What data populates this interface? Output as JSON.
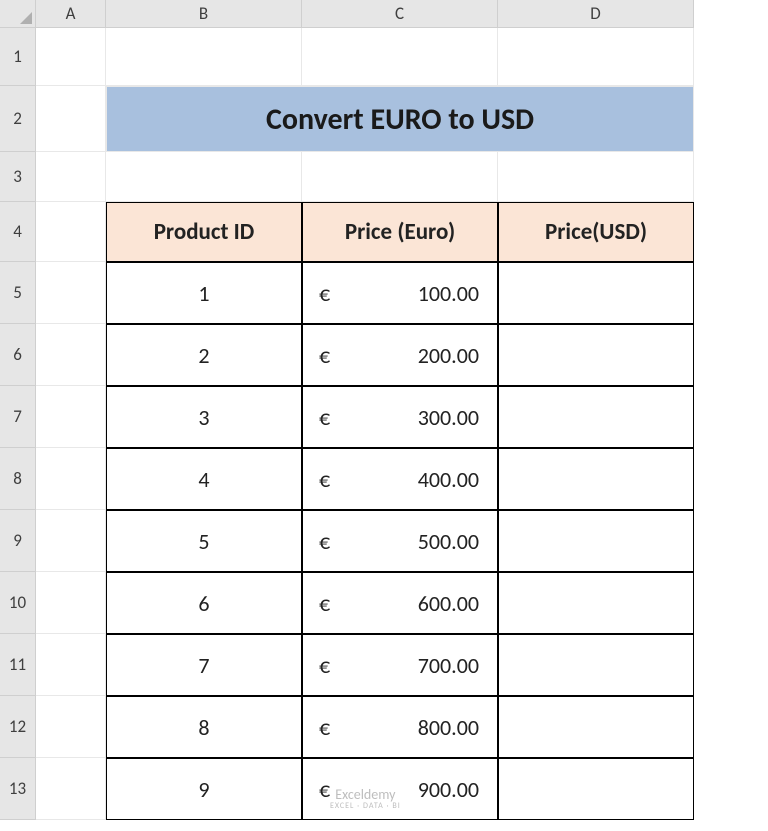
{
  "columns": [
    "A",
    "B",
    "C",
    "D"
  ],
  "row_labels": [
    "1",
    "2",
    "3",
    "4",
    "5",
    "6",
    "7",
    "8",
    "9",
    "10",
    "11",
    "12",
    "13"
  ],
  "title": "Convert EURO to USD",
  "headers": {
    "product_id": "Product ID",
    "price_euro": "Price (Euro)",
    "price_usd": "Price(USD)"
  },
  "currency_symbol": "€",
  "table": {
    "rows": [
      {
        "id": "1",
        "euro": "100.00",
        "usd": ""
      },
      {
        "id": "2",
        "euro": "200.00",
        "usd": ""
      },
      {
        "id": "3",
        "euro": "300.00",
        "usd": ""
      },
      {
        "id": "4",
        "euro": "400.00",
        "usd": ""
      },
      {
        "id": "5",
        "euro": "500.00",
        "usd": ""
      },
      {
        "id": "6",
        "euro": "600.00",
        "usd": ""
      },
      {
        "id": "7",
        "euro": "700.00",
        "usd": ""
      },
      {
        "id": "8",
        "euro": "800.00",
        "usd": ""
      },
      {
        "id": "9",
        "euro": "900.00",
        "usd": ""
      }
    ]
  },
  "watermark": {
    "main": "Exceldemy",
    "sub": "EXCEL · DATA · BI"
  },
  "colors": {
    "title_bg": "#a8c0de",
    "header_bg": "#fbe5d6",
    "row_head_bg": "#e6e6e6"
  }
}
